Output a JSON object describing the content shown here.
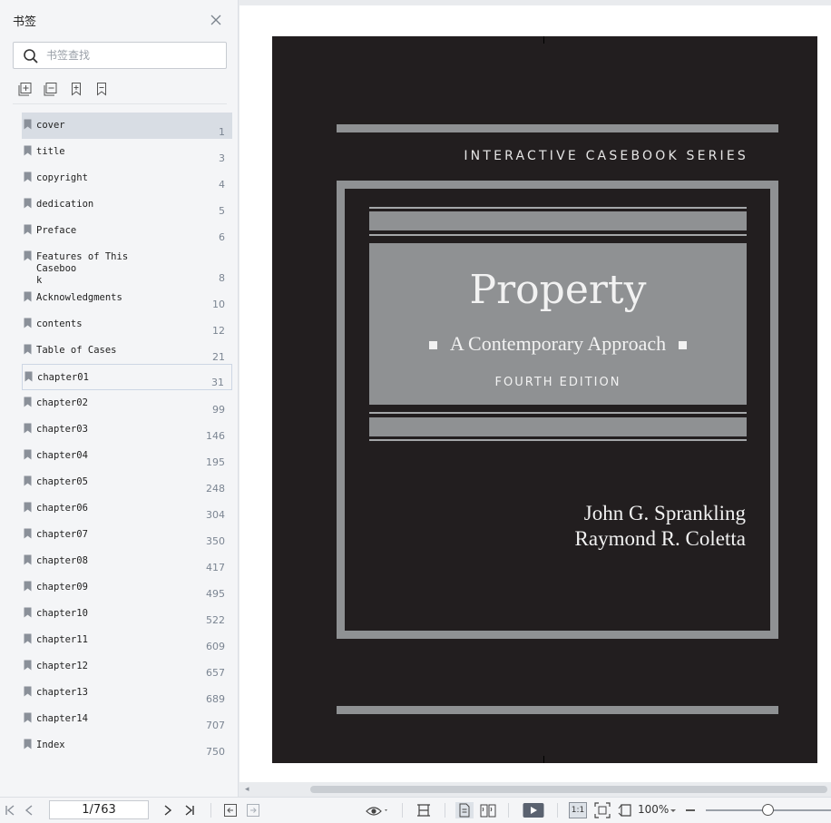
{
  "sidebar": {
    "title": "书签",
    "search_placeholder": "书签查找",
    "bookmarks": [
      {
        "label": "cover",
        "page": "1"
      },
      {
        "label": "title",
        "page": "3"
      },
      {
        "label": "copyright",
        "page": "4"
      },
      {
        "label": "dedication",
        "page": "5"
      },
      {
        "label": "Preface",
        "page": "6"
      },
      {
        "label": "Features of This Caseboo\nk",
        "page": "8"
      },
      {
        "label": "Acknowledgments",
        "page": "10"
      },
      {
        "label": "contents",
        "page": "12"
      },
      {
        "label": "Table of Cases",
        "page": "21"
      },
      {
        "label": "chapter01",
        "page": "31"
      },
      {
        "label": "chapter02",
        "page": "99"
      },
      {
        "label": "chapter03",
        "page": "146"
      },
      {
        "label": "chapter04",
        "page": "195"
      },
      {
        "label": "chapter05",
        "page": "248"
      },
      {
        "label": "chapter06",
        "page": "304"
      },
      {
        "label": "chapter07",
        "page": "350"
      },
      {
        "label": "chapter08",
        "page": "417"
      },
      {
        "label": "chapter09",
        "page": "495"
      },
      {
        "label": "chapter10",
        "page": "522"
      },
      {
        "label": "chapter11",
        "page": "609"
      },
      {
        "label": "chapter12",
        "page": "657"
      },
      {
        "label": "chapter13",
        "page": "689"
      },
      {
        "label": "chapter14",
        "page": "707"
      },
      {
        "label": "Index",
        "page": "750"
      }
    ]
  },
  "cover": {
    "series": "INTERACTIVE CASEBOOK SERIES",
    "title": "Property",
    "subtitle": "A Contemporary Approach",
    "edition": "FOURTH EDITION",
    "author1": "John G. Sprankling",
    "author2": "Raymond R. Coletta"
  },
  "toolbar": {
    "page_indicator": "1/763",
    "actual_size_label": "1:1",
    "zoom": "100%"
  },
  "colors": {
    "cover_bg": "#221e1f",
    "cover_gray": "#8f9193",
    "sidebar_bg": "#f4f5f7",
    "active_row": "#d8dde4"
  }
}
